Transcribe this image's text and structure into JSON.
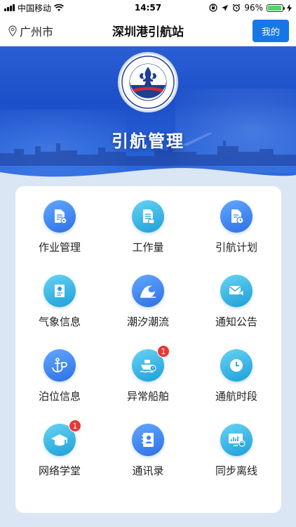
{
  "status": {
    "carrier": "中国移动",
    "time": "14:57",
    "battery": "96%"
  },
  "nav": {
    "location": "广州市",
    "title": "深圳港引航站",
    "my_button": "我的"
  },
  "banner": {
    "title": "引航管理",
    "logo_text_top": "深圳引航",
    "logo_text_ring": "SHENZHEN MARITIME PILOTS"
  },
  "menu": {
    "items": [
      {
        "label": "作业管理",
        "icon": "document-gear-icon"
      },
      {
        "label": "工作量",
        "icon": "document-stack-icon"
      },
      {
        "label": "引航计划",
        "icon": "document-clock-icon"
      },
      {
        "label": "气象信息",
        "icon": "weather-report-icon"
      },
      {
        "label": "潮汐潮流",
        "icon": "wave-icon"
      },
      {
        "label": "通知公告",
        "icon": "mail-speaker-icon"
      },
      {
        "label": "泊位信息",
        "icon": "anchor-berth-icon"
      },
      {
        "label": "异常船舶",
        "icon": "ship-alert-icon",
        "badge": "1"
      },
      {
        "label": "通航时段",
        "icon": "clock-icon"
      },
      {
        "label": "网络学堂",
        "icon": "graduation-cap-icon",
        "badge": "1"
      },
      {
        "label": "通讯录",
        "icon": "contacts-book-icon"
      },
      {
        "label": "同步离线",
        "icon": "sync-monitor-icon"
      }
    ]
  }
}
